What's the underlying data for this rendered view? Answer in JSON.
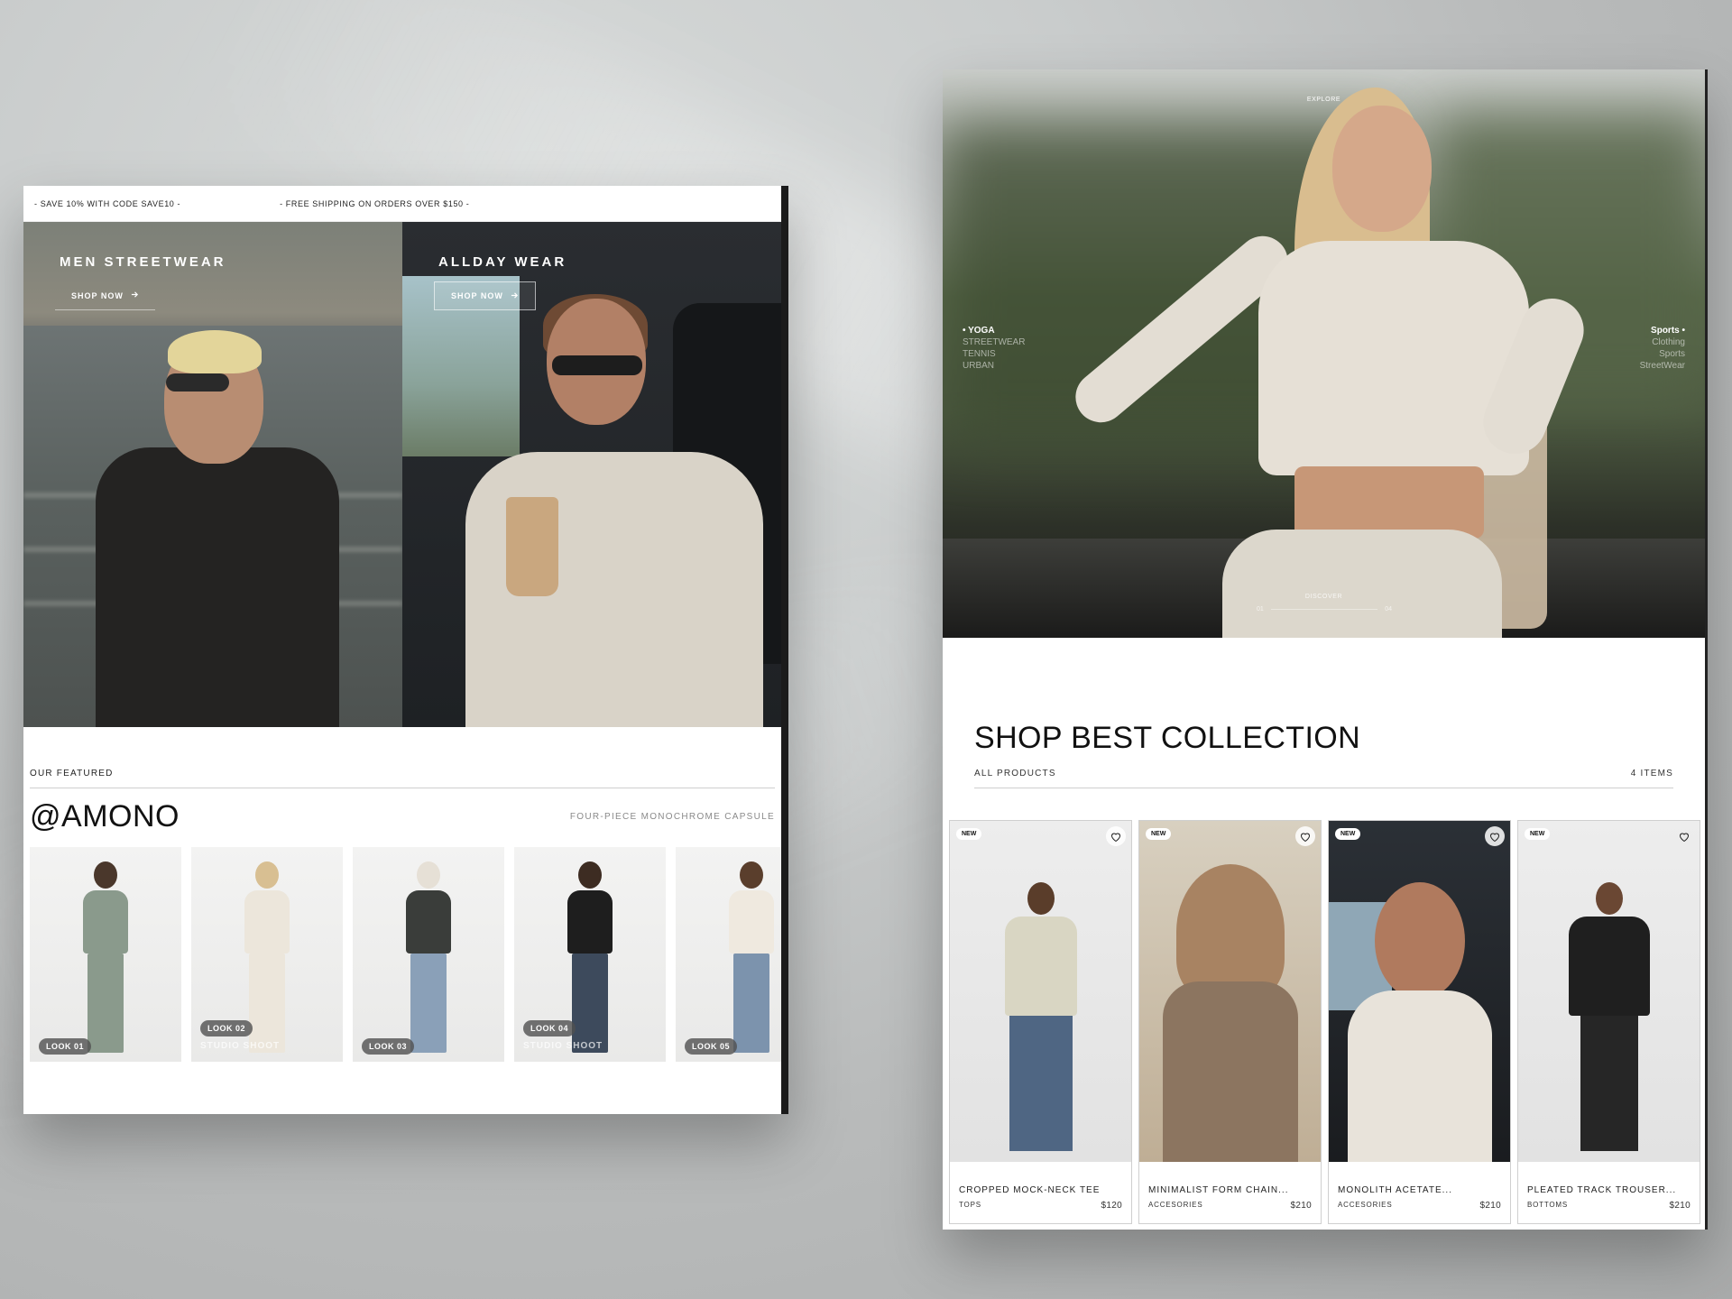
{
  "left_page": {
    "announcement": {
      "left": "- SAVE 10% WITH CODE SAVE10 -",
      "right": "- FREE SHIPPING ON ORDERS OVER $150 -"
    },
    "hero_panels": [
      {
        "title": "MEN STREETWEAR",
        "cta": "SHOP NOW"
      },
      {
        "title": "ALLDAY WEAR",
        "cta": "SHOP NOW"
      }
    ],
    "featured": {
      "label": "OUR FEATURED",
      "title": "@AMONO",
      "subtitle": "FOUR-PIECE MONOCHROME CAPSULE",
      "looks": [
        {
          "badge": "LOOK 01",
          "sub": ""
        },
        {
          "badge": "LOOK 02",
          "sub": "STUDIO SHOOT"
        },
        {
          "badge": "LOOK 03",
          "sub": ""
        },
        {
          "badge": "LOOK 04",
          "sub": "STUDIO SHOOT"
        },
        {
          "badge": "LOOK 05",
          "sub": ""
        }
      ]
    }
  },
  "right_page": {
    "hero": {
      "top_label": "EXPLORE",
      "left_menu": {
        "active": "YOGA",
        "items": [
          "STREETWEAR",
          "TENNIS",
          "URBAN"
        ]
      },
      "right_menu": {
        "active": "Sports",
        "items": [
          "Clothing",
          "Sports",
          "StreetWear"
        ]
      },
      "discover": "DISCOVER",
      "slide_start": "01",
      "slide_end": "04"
    },
    "collection": {
      "title": "SHOP BEST COLLECTION",
      "filter": "ALL PRODUCTS",
      "count": "4 ITEMS",
      "products": [
        {
          "badge": "NEW",
          "name": "CROPPED MOCK-NECK TEE",
          "category": "TOPS",
          "price": "$120"
        },
        {
          "badge": "NEW",
          "name": "MINIMALIST FORM CHAIN...",
          "category": "ACCESORIES",
          "price": "$210"
        },
        {
          "badge": "NEW",
          "name": "MONOLITH ACETATE...",
          "category": "ACCESORIES",
          "price": "$210"
        },
        {
          "badge": "NEW",
          "name": "PLEATED TRACK TROUSER...",
          "category": "BOTTOMS",
          "price": "$210"
        }
      ]
    }
  },
  "icons": {
    "arrow": "arrow-right-icon",
    "wishlist": "heart-icon"
  }
}
